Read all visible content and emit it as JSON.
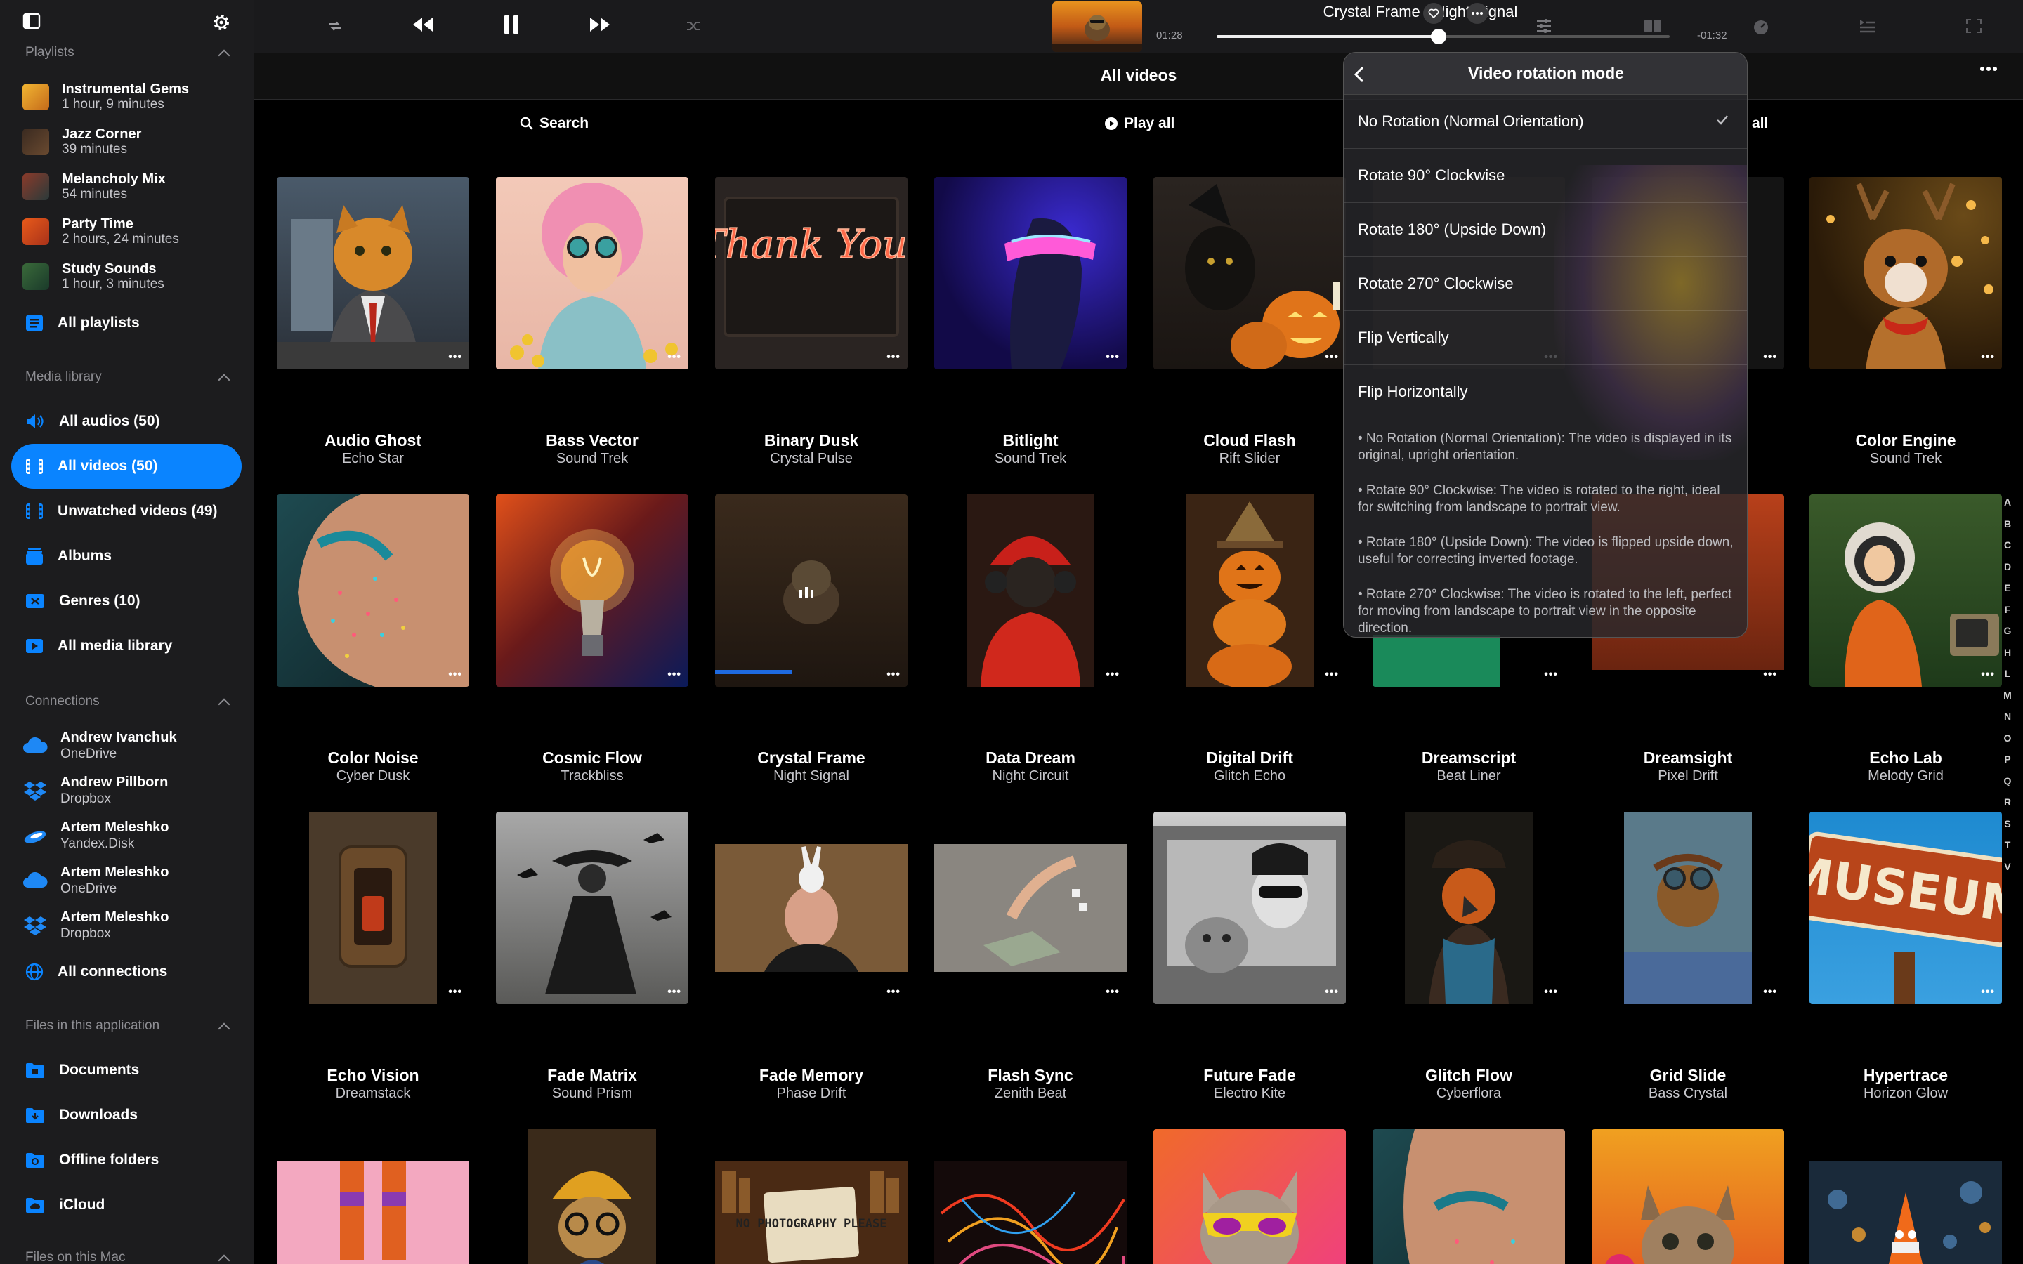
{
  "colors": {
    "accent": "#0a84ff",
    "sidebar_bg": "#1c1c1e",
    "main_bg": "#000000"
  },
  "sidebar": {
    "playlists_header": "Playlists",
    "playlists": [
      {
        "title": "Instrumental Gems",
        "duration": "1 hour, 9 minutes"
      },
      {
        "title": "Jazz Corner",
        "duration": "39 minutes"
      },
      {
        "title": "Melancholy Mix",
        "duration": "54 minutes"
      },
      {
        "title": "Party Time",
        "duration": "2 hours, 24 minutes"
      },
      {
        "title": "Study Sounds",
        "duration": "1 hour, 3 minutes"
      }
    ],
    "all_playlists": "All playlists",
    "media_header": "Media library",
    "media": [
      {
        "label": "All audios (50)",
        "icon": "speaker-icon"
      },
      {
        "label": "All videos (50)",
        "icon": "film-icon"
      },
      {
        "label": "Unwatched videos (49)",
        "icon": "film-icon"
      },
      {
        "label": "Albums",
        "icon": "albums-icon"
      },
      {
        "label": "Genres (10)",
        "icon": "genres-icon"
      },
      {
        "label": "All media library",
        "icon": "media-library-icon"
      }
    ],
    "connections_header": "Connections",
    "connections": [
      {
        "name": "Andrew Ivanchuk",
        "service": "OneDrive",
        "icon": "onedrive-icon"
      },
      {
        "name": "Andrew Pillborn",
        "service": "Dropbox",
        "icon": "dropbox-icon"
      },
      {
        "name": "Artem Meleshko",
        "service": "Yandex.Disk",
        "icon": "yandex-disk-icon"
      },
      {
        "name": "Artem Meleshko",
        "service": "OneDrive",
        "icon": "onedrive-icon"
      },
      {
        "name": "Artem Meleshko",
        "service": "Dropbox",
        "icon": "dropbox-icon"
      }
    ],
    "all_connections": "All connections",
    "files_header": "Files in this application",
    "files": [
      {
        "label": "Documents",
        "icon": "documents-folder-icon"
      },
      {
        "label": "Downloads",
        "icon": "downloads-folder-icon"
      },
      {
        "label": "Offline folders",
        "icon": "offline-folder-icon"
      },
      {
        "label": "iCloud",
        "icon": "icloud-folder-icon"
      }
    ],
    "mac_header": "Files on this Mac"
  },
  "player": {
    "title": "Crystal Frame • Night Signal",
    "elapsed": "01:28",
    "remaining": "-01:32",
    "progress": 0.49
  },
  "main": {
    "title": "All videos",
    "search": "Search",
    "play_all": "Play all",
    "shuffle_all_partial": "all"
  },
  "grid": [
    {
      "title": "Audio Ghost",
      "artist": "Echo Star"
    },
    {
      "title": "Bass Vector",
      "artist": "Sound Trek"
    },
    {
      "title": "Binary Dusk",
      "artist": "Crystal Pulse"
    },
    {
      "title": "Bitlight",
      "artist": "Sound Trek"
    },
    {
      "title": "Cloud Flash",
      "artist": "Rift Slider"
    },
    {
      "title": "",
      "artist": ""
    },
    {
      "title": "",
      "artist": ""
    },
    {
      "title": "Color Engine",
      "artist": "Sound Trek"
    },
    {
      "title": "Color Noise",
      "artist": "Cyber Dusk"
    },
    {
      "title": "Cosmic Flow",
      "artist": "Trackbliss"
    },
    {
      "title": "Crystal Frame",
      "artist": "Night Signal"
    },
    {
      "title": "Data Dream",
      "artist": "Night Circuit"
    },
    {
      "title": "Digital Drift",
      "artist": "Glitch Echo"
    },
    {
      "title": "Dreamscript",
      "artist": "Beat Liner"
    },
    {
      "title": "Dreamsight",
      "artist": "Pixel Drift"
    },
    {
      "title": "Echo Lab",
      "artist": "Melody Grid"
    },
    {
      "title": "Echo Vision",
      "artist": "Dreamstack"
    },
    {
      "title": "Fade Matrix",
      "artist": "Sound Prism"
    },
    {
      "title": "Fade Memory",
      "artist": "Phase Drift"
    },
    {
      "title": "Flash Sync",
      "artist": "Zenith Beat"
    },
    {
      "title": "Future Fade",
      "artist": "Electro Kite"
    },
    {
      "title": "Glitch Flow",
      "artist": "Cyberflora"
    },
    {
      "title": "Grid Slide",
      "artist": "Bass Crystal"
    },
    {
      "title": "Hypertrace",
      "artist": "Horizon Glow"
    }
  ],
  "art_text": {
    "thank_you": "Thank You!",
    "museum": "MUSEUM",
    "no_photo": "NO PHOTOGRAPHY PLEASE"
  },
  "az_index": [
    "A",
    "B",
    "C",
    "D",
    "E",
    "F",
    "G",
    "H",
    "L",
    "M",
    "N",
    "O",
    "P",
    "Q",
    "R",
    "S",
    "T",
    "V"
  ],
  "popup": {
    "title": "Video rotation mode",
    "options": [
      "No Rotation (Normal Orientation)",
      "Rotate 90° Clockwise",
      "Rotate 180° (Upside Down)",
      "Rotate 270° Clockwise",
      "Flip Vertically",
      "Flip Horizontally"
    ],
    "selected_index": 0,
    "descriptions": [
      "• No Rotation (Normal Orientation): The video is displayed in its original, upright orientation.",
      "• Rotate 90° Clockwise: The video is rotated to the right, ideal for switching from landscape to portrait view.",
      "• Rotate 180° (Upside Down): The video is flipped upside down, useful for correcting inverted footage.",
      "• Rotate 270° Clockwise: The video is rotated to the left, perfect for moving from landscape to portrait view in the opposite direction."
    ]
  }
}
